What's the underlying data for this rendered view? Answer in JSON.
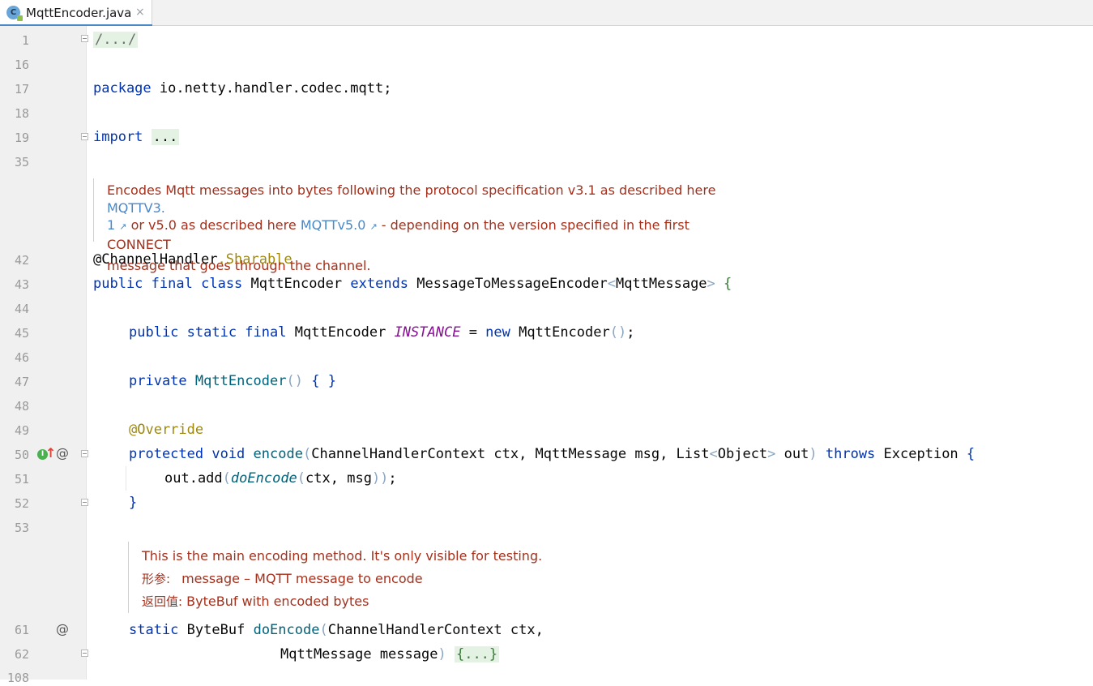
{
  "tab": {
    "title": "MqttEncoder.java",
    "icon_letter": "C",
    "close": "×"
  },
  "line_numbers": [
    "1",
    "16",
    "17",
    "18",
    "19",
    "35",
    "42",
    "43",
    "44",
    "45",
    "46",
    "47",
    "48",
    "49",
    "50",
    "51",
    "52",
    "53",
    "61",
    "62",
    "108"
  ],
  "code": {
    "l1": "/.../",
    "l17_kw": "package",
    "l17_rest": " io.netty.handler.codec.mqtt;",
    "l19_kw": "import",
    "l19_fold": "...",
    "l42_at": "@ChannelHandler",
    "l42_dot": ".Sharable",
    "l43_kw1": "public",
    "l43_kw2": "final",
    "l43_kw3": "class",
    "l43_name": "MqttEncoder",
    "l43_kw4": "extends",
    "l43_super": "MessageToMessageEncoder",
    "l43_lt": "<",
    "l43_generic": "MqttMessage",
    "l43_gt": ">",
    "l43_brace": "{",
    "l45_kw": "public static final",
    "l45_type": "MqttEncoder",
    "l45_field": "INSTANCE",
    "l45_eq": " = ",
    "l45_new": "new",
    "l45_ctor": "MqttEncoder",
    "l45_paren": "()",
    "l45_semi": ";",
    "l47_kw": "private",
    "l47_ctor": "MqttEncoder",
    "l47_paren": "()",
    "l47_body": "{ }",
    "l49_ann": "@Override",
    "l50_kw": "protected void",
    "l50_method": "encode",
    "l50_open": "(",
    "l50_params": "ChannelHandlerContext ctx, MqttMessage msg, List",
    "l50_lt": "<",
    "l50_obj": "Object",
    "l50_gt": ">",
    "l50_out": " out",
    "l50_close": ")",
    "l50_throws": "throws",
    "l50_exc": "Exception",
    "l50_brace": "{",
    "l51_recv": "out.add",
    "l51_open": "(",
    "l51_call": "doEncode",
    "l51_args_open": "(",
    "l51_args": "ctx, msg",
    "l51_args_close": "))",
    "l51_semi": ";",
    "l52_brace": "}",
    "l61_kw": "static",
    "l61_type": "ByteBuf",
    "l61_method": "doEncode",
    "l61_open": "(",
    "l61_params": "ChannelHandlerContext ctx,",
    "l62_params": "MqttMessage message",
    "l62_close": ")",
    "l62_fold": "{...}"
  },
  "doc1": {
    "text1": "Encodes Mqtt messages into bytes following the protocol specification v3.1 as described here ",
    "link1a": "MQTTV3.",
    "link1b": "1",
    "text2": " or v5.0 as described here ",
    "link2": "MQTTv5.0",
    "text3": " - depending on the version specified in the first CONNECT",
    "text4": "message that goes through the channel.",
    "ext_icon": "↗"
  },
  "doc2": {
    "line1": "This is the main encoding method. It's only visible for testing.",
    "param_label": "形参:",
    "param_text": "message – MQTT message to encode",
    "return_label": "返回值:",
    "return_text": "ByteBuf with encoded bytes"
  },
  "gutter_icons": {
    "at": "@",
    "impl": "I",
    "up": "↑"
  }
}
